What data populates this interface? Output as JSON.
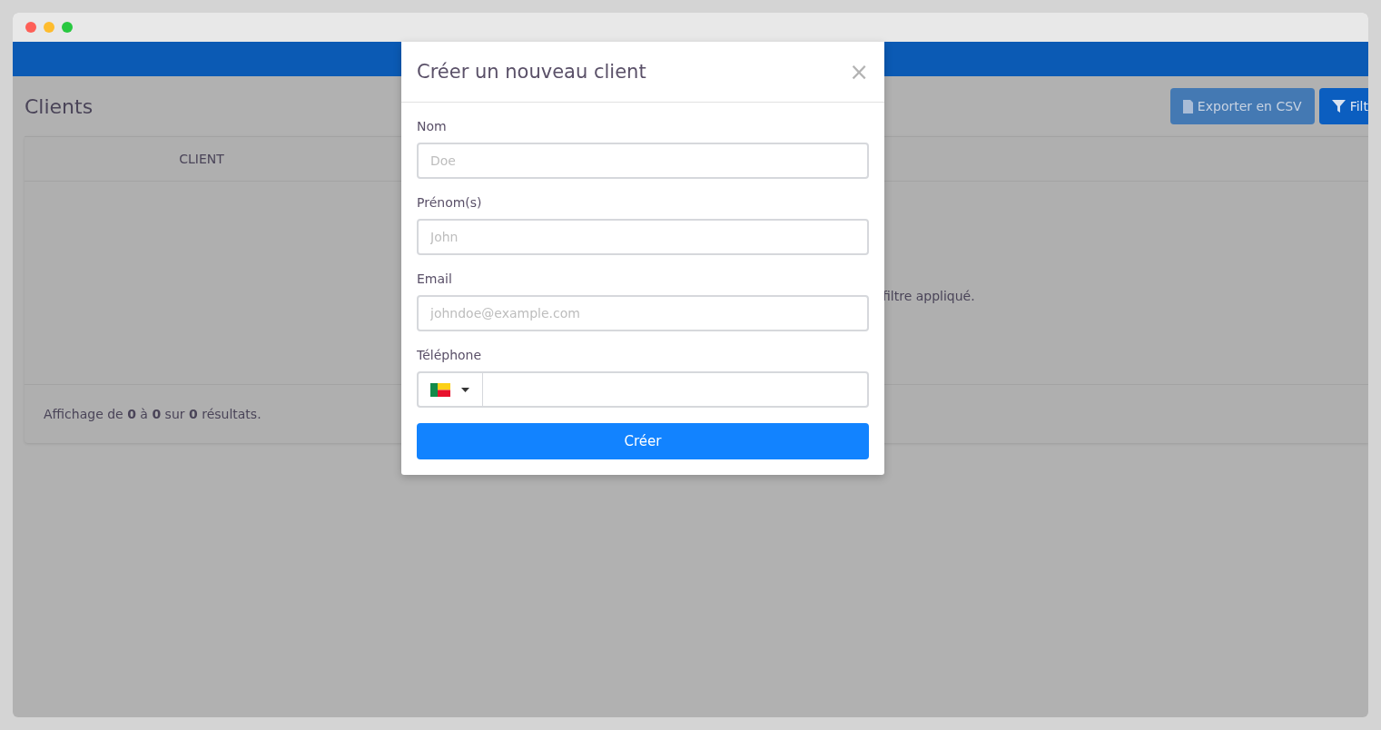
{
  "page": {
    "title": "Clients",
    "actions": [
      {
        "label": "Exporter en CSV",
        "kind": "export"
      },
      {
        "label": "Filt",
        "kind": "filter"
      }
    ],
    "table": {
      "columns": [
        "CLIENT"
      ],
      "empty_message": "filtre appliqué.",
      "footer": "Affichage de **0** à **0** sur **0** résultats."
    }
  },
  "modal": {
    "title": "Créer un nouveau client",
    "close": "×",
    "fields": [
      {
        "label": "Nom",
        "placeholder": "Doe",
        "kind": "text"
      },
      {
        "label": "Prénom(s)",
        "placeholder": "John",
        "kind": "text"
      },
      {
        "label": "Email",
        "placeholder": "johndoe@example.com",
        "kind": "text"
      },
      {
        "label": "Téléphone",
        "kind": "phone"
      }
    ],
    "submit": "Créer"
  }
}
